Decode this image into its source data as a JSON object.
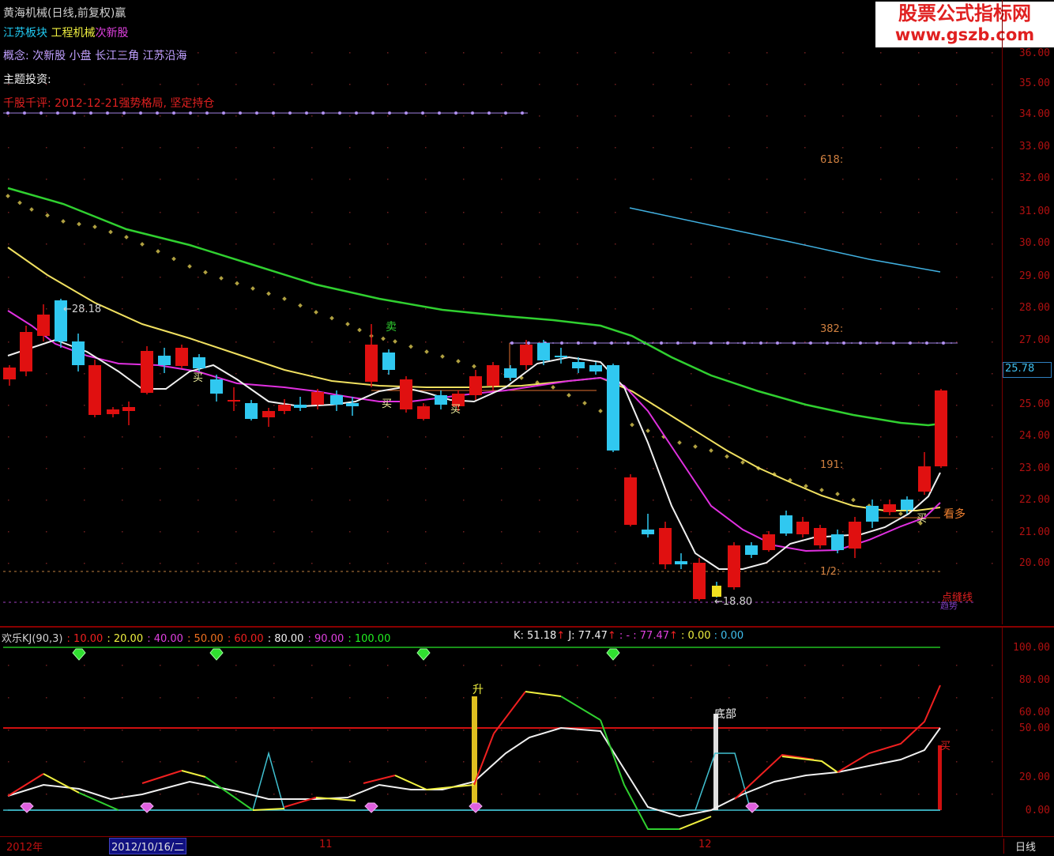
{
  "stock_title": "黄海机械(日线,前复权)",
  "title_glyph": "赢",
  "sector_tags": [
    {
      "label": "江苏板块",
      "color": "#20c8f0"
    },
    {
      "label": "工程机械",
      "color": "#f0f040"
    },
    {
      "label": "次新股",
      "color": "#e040e0"
    }
  ],
  "concept_line": "概念: 次新股 小盘 长江三角 江苏沿海",
  "theme_line": "主题投资:",
  "comment_line": "千股千评: 2012-12-21强势格局, 坚定持仓",
  "watermark": {
    "line1": "股票公式指标网",
    "line2": "www.gszb.com"
  },
  "price_axis": [
    "36.00",
    "35.00",
    "34.00",
    "33.00",
    "32.00",
    "31.00",
    "30.00",
    "29.00",
    "28.00",
    "27.00",
    "25.00",
    "24.00",
    "23.00",
    "22.00",
    "21.00",
    "20.00"
  ],
  "current_price": "25.78",
  "fib_labels": {
    "f618": "618:",
    "f382": "382:",
    "f191": "191:",
    "f12": "1/2:"
  },
  "high_label": "←28.18",
  "low_label": "←18.80",
  "support_label": "点缝线",
  "support_label2": "趋势",
  "bullish_label": "看多",
  "sell_label": "卖",
  "buy_label": "买",
  "kj": {
    "name": "欢乐KJ(90,3)",
    "levels": [
      ": 10.00",
      ": 20.00",
      ": 40.00",
      ": 50.00",
      ": 60.00",
      ": 80.00",
      ": 90.00",
      ": 100.00"
    ],
    "level_colors": [
      "#f02020",
      "#f0f040",
      "#e040e0",
      "#f07020",
      "#f02020",
      "#f0f0f0",
      "#f02020",
      "#20f020"
    ],
    "k_value": "K: 51.18",
    "j_value": "J: 77.47",
    "extra1": ": -",
    "extra2": ": 77.47",
    "extra3": ": 0.00",
    "extra4": ": 0.00",
    "axis": [
      "100.00",
      "80.00",
      "60.00",
      "50.00",
      "20.00",
      "0.00"
    ],
    "rise_label": "升",
    "bottom_label": "底部",
    "buy_label": "买"
  },
  "dates": {
    "year": "2012年",
    "cursor_date": "2012/10/16/二",
    "nov": "11",
    "dec": "12"
  },
  "period_label": "日线",
  "colors": {
    "up": "#e01010",
    "down": "#30c8f0",
    "ma_green": "#30d030",
    "ma_yellow": "#f0e060",
    "ma_white": "#f0f0f0",
    "ma_magenta": "#e030e0",
    "dots": "#b0a040"
  }
}
